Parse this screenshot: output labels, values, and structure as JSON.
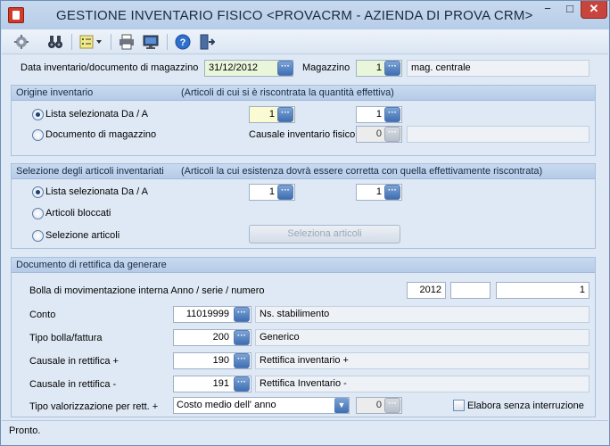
{
  "window": {
    "title": "GESTIONE INVENTARIO FISICO <PROVACRM - AZIENDA DI PROVA CRM>",
    "min": "−",
    "max": "□",
    "close": "✕"
  },
  "toolbar": {
    "icons": [
      "gear-icon",
      "binoculars-icon",
      "list-dropdown-icon",
      "printer-icon",
      "monitor-icon",
      "help-icon",
      "exit-door-icon"
    ]
  },
  "header": {
    "date_label": "Data inventario/documento di magazzino",
    "date_value": "31/12/2012",
    "store_label": "Magazzino",
    "store_value": "1",
    "store_desc": "mag. centrale"
  },
  "origin": {
    "title": "Origine inventario",
    "note": "(Articoli di cui si è riscontrata la quantità effettiva)",
    "opt_list": "Lista selezionata Da / A",
    "from": "1",
    "to": "1",
    "opt_doc": "Documento di magazzino",
    "causale_label": "Causale inventario fisico",
    "causale_value": "0",
    "causale_desc": ""
  },
  "selection": {
    "title": "Selezione degli articoli inventariati",
    "note": "(Articoli la cui esistenza dovrà essere corretta con quella effettivamente riscontrata)",
    "opt_list": "Lista selezionata Da / A",
    "from": "1",
    "to": "1",
    "opt_blocked": "Articoli bloccati",
    "opt_sel": "Selezione articoli",
    "sel_button": "Seleziona articoli"
  },
  "document": {
    "title": "Documento di rettifica da generare",
    "bolla_label": "Bolla di movimentazione interna Anno / serie / numero",
    "bolla_year": "2012",
    "bolla_series": "",
    "bolla_number": "1",
    "conto_label": "Conto",
    "conto_value": "11019999",
    "conto_desc": "Ns. stabilimento",
    "tipo_label": "Tipo bolla/fattura",
    "tipo_value": "200",
    "tipo_desc": "Generico",
    "caus_plus_label": "Causale in rettifica +",
    "caus_plus_value": "190",
    "caus_plus_desc": "Rettifica inventario +",
    "caus_minus_label": "Causale in rettifica -",
    "caus_minus_value": "191",
    "caus_minus_desc": "Rettifica Inventario -",
    "val_label": "Tipo valorizzazione  per rett. +",
    "val_select": "Costo medio dell' anno",
    "val_num": "0",
    "elab_label": "Elabora senza interruzione"
  },
  "status": {
    "text": "Pronto."
  },
  "colors": {
    "accent": "#3f6eb2",
    "background": "#dfe9f5",
    "section_header": "#b5cbe7"
  }
}
